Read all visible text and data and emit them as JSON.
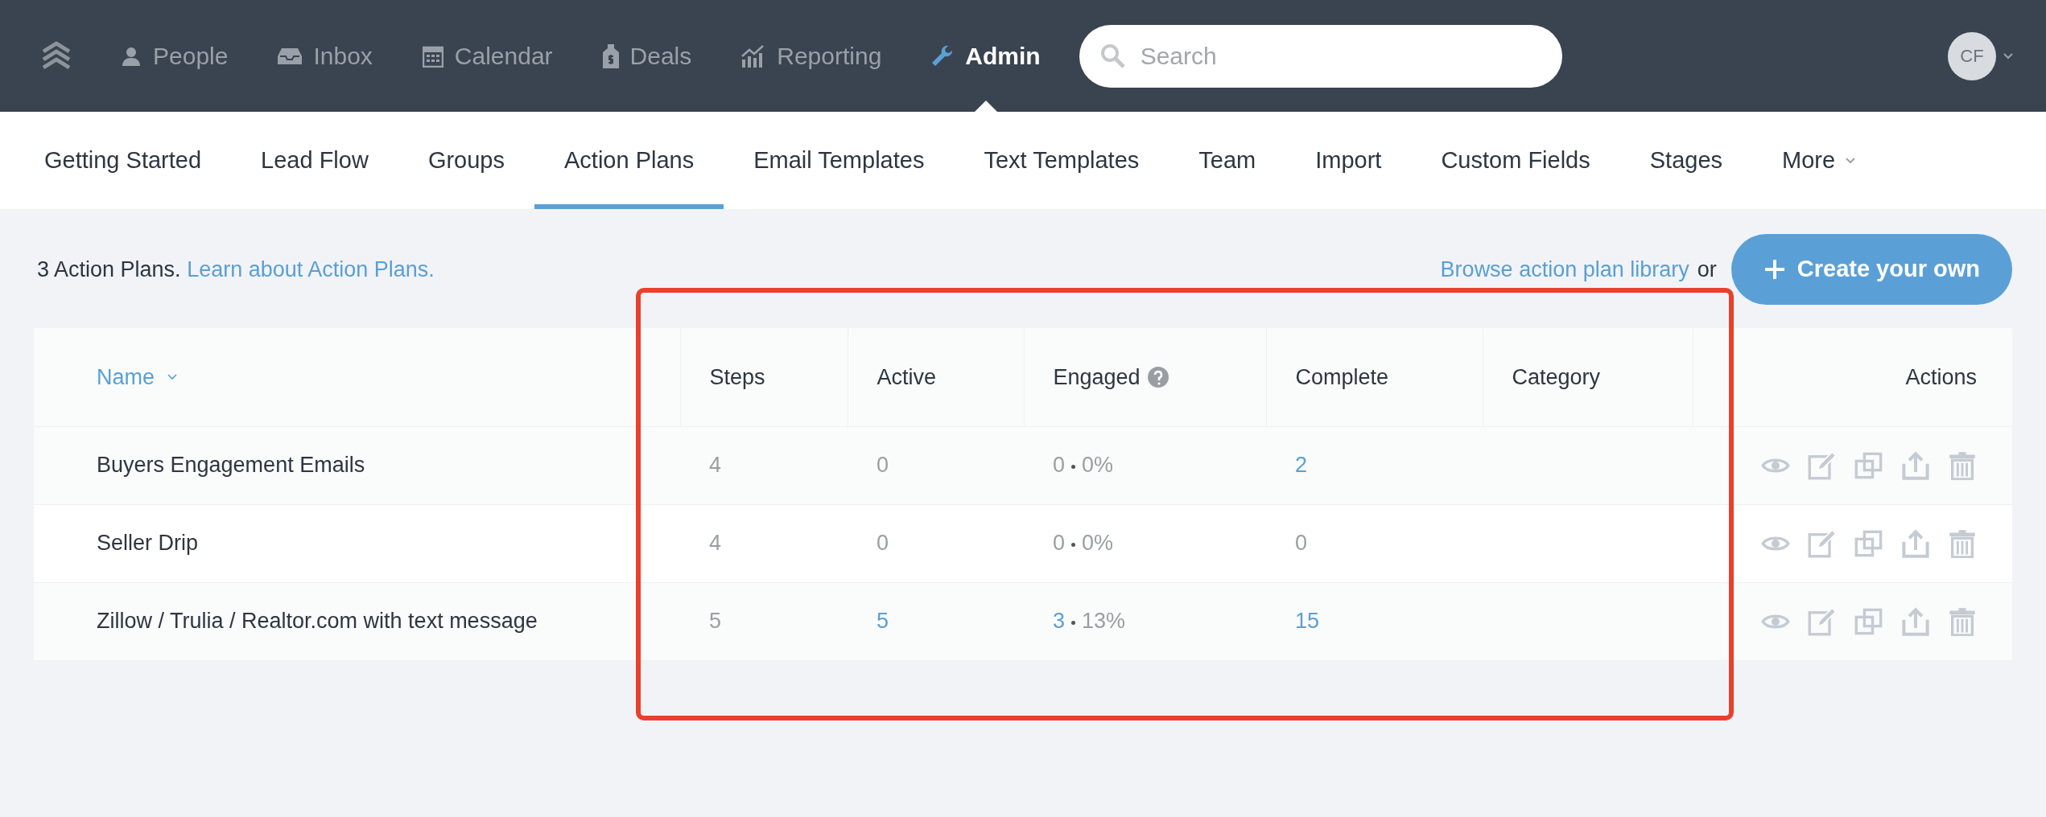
{
  "topnav": {
    "items": [
      {
        "label": "People",
        "selected": false
      },
      {
        "label": "Inbox",
        "selected": false
      },
      {
        "label": "Calendar",
        "selected": false
      },
      {
        "label": "Deals",
        "selected": false
      },
      {
        "label": "Reporting",
        "selected": false
      },
      {
        "label": "Admin",
        "selected": true
      }
    ],
    "search": {
      "placeholder": "Search"
    },
    "avatar": {
      "initials": "CF"
    }
  },
  "subnav": {
    "tabs": [
      {
        "label": "Getting Started",
        "selected": false
      },
      {
        "label": "Lead Flow",
        "selected": false
      },
      {
        "label": "Groups",
        "selected": false
      },
      {
        "label": "Action Plans",
        "selected": true
      },
      {
        "label": "Email Templates",
        "selected": false
      },
      {
        "label": "Text Templates",
        "selected": false
      },
      {
        "label": "Team",
        "selected": false
      },
      {
        "label": "Import",
        "selected": false
      },
      {
        "label": "Custom Fields",
        "selected": false
      },
      {
        "label": "Stages",
        "selected": false
      },
      {
        "label": "More",
        "selected": false
      }
    ]
  },
  "summary": {
    "count_text": "3 Action Plans.",
    "learn_link": "Learn about Action Plans.",
    "browse_link": "Browse action plan library",
    "or_text": "or",
    "create_button": "Create your own"
  },
  "table": {
    "columns": [
      "Name",
      "Steps",
      "Active",
      "Engaged",
      "Complete",
      "Category",
      "Actions"
    ],
    "rows": [
      {
        "name": "Buyers Engagement Emails",
        "steps": "4",
        "active": {
          "text": "0",
          "link": false
        },
        "engaged": {
          "count": "0",
          "link": false,
          "percent": "0%"
        },
        "complete": {
          "text": "2",
          "link": true
        }
      },
      {
        "name": "Seller Drip",
        "steps": "4",
        "active": {
          "text": "0",
          "link": false
        },
        "engaged": {
          "count": "0",
          "link": false,
          "percent": "0%"
        },
        "complete": {
          "text": "0",
          "link": false
        }
      },
      {
        "name": "Zillow / Trulia / Realtor.com with text message",
        "steps": "5",
        "active": {
          "text": "5",
          "link": true
        },
        "engaged": {
          "count": "3",
          "link": true,
          "percent": "13%"
        },
        "complete": {
          "text": "15",
          "link": true
        }
      }
    ]
  }
}
